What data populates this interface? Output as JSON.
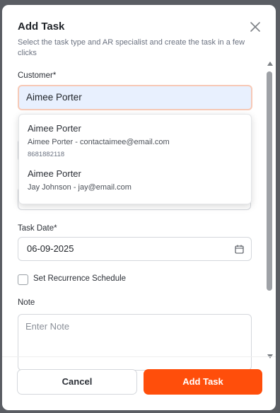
{
  "modal": {
    "title": "Add Task",
    "subtitle": "Select the task type and AR specialist and create the task in a few clicks"
  },
  "customer": {
    "label": "Customer*",
    "value": "Aimee Porter",
    "suggestions": [
      {
        "name": "Aimee Porter",
        "detail": "Aimee Porter - contactaimee@email.com",
        "phone": "8681882118"
      },
      {
        "name": "Aimee Porter",
        "detail": "Jay Johnson - jay@email.com",
        "phone": ""
      }
    ]
  },
  "task_date": {
    "label": "Task Date*",
    "value": "06-09-2025",
    "icon": "calendar-icon"
  },
  "recurrence": {
    "label": "Set Recurrence Schedule",
    "checked": false
  },
  "note": {
    "label": "Note",
    "placeholder": "Enter Note"
  },
  "footer": {
    "cancel_label": "Cancel",
    "add_label": "Add Task"
  },
  "colors": {
    "accent": "#ff4e0b",
    "input_focus_bg": "#e8f0fe",
    "input_focus_border": "#f7c9b6"
  }
}
